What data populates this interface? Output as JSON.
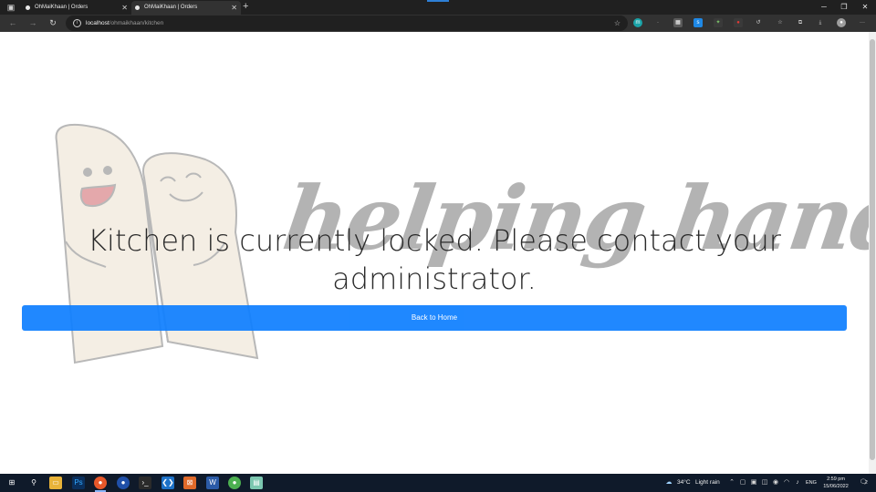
{
  "browser": {
    "tabs": [
      {
        "title": "OhMaiKhaan | Orders"
      },
      {
        "title": "OhMaiKhaan | Orders"
      }
    ],
    "address": {
      "host": "localhost",
      "path": "/ohmaikhaan/kitchen"
    }
  },
  "page": {
    "watermark_text": "helping hand",
    "message": "Kitchen is currently locked. Please contact your administrator.",
    "back_button": "Back to Home"
  },
  "taskbar": {
    "weather_temp": "34°C",
    "weather_desc": "Light rain",
    "language": "ENG",
    "time": "2:59 pm",
    "date": "15/06/2022",
    "notification_count": "2"
  },
  "colors": {
    "primary_button": "#0d7eff",
    "chrome_dark": "#202020",
    "taskbar": "#0f1a2a"
  }
}
